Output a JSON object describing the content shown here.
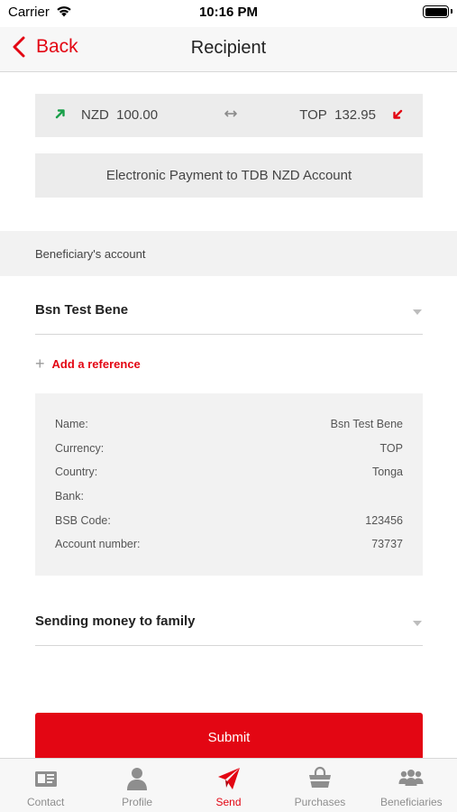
{
  "status_bar": {
    "carrier": "Carrier",
    "time": "10:16 PM"
  },
  "nav": {
    "back_label": "Back",
    "title": "Recipient"
  },
  "exchange": {
    "from_currency": "NZD",
    "from_amount": "100.00",
    "to_currency": "TOP",
    "to_amount": "132.95"
  },
  "payment_method": "Electronic Payment to TDB NZD Account",
  "beneficiary_section": {
    "header": "Beneficiary's account",
    "selected": "Bsn Test Bene"
  },
  "add_reference_label": "Add a reference",
  "details": [
    {
      "label": "Name:",
      "value": "Bsn Test Bene"
    },
    {
      "label": "Currency:",
      "value": "TOP"
    },
    {
      "label": "Country:",
      "value": "Tonga"
    },
    {
      "label": "Bank:",
      "value": ""
    },
    {
      "label": "BSB Code:",
      "value": "123456"
    },
    {
      "label": "Account number:",
      "value": "73737"
    }
  ],
  "purpose": {
    "selected": "Sending money to family"
  },
  "submit_label": "Submit",
  "tabs": [
    {
      "label": "Contact",
      "icon": "contact-card-icon",
      "active": false
    },
    {
      "label": "Profile",
      "icon": "person-icon",
      "active": false
    },
    {
      "label": "Send",
      "icon": "paper-plane-icon",
      "active": true
    },
    {
      "label": "Purchases",
      "icon": "basket-icon",
      "active": false
    },
    {
      "label": "Beneficiaries",
      "icon": "group-icon",
      "active": false
    }
  ],
  "colors": {
    "accent": "#e30613",
    "up_arrow": "#1aa04a",
    "inactive_tab": "#8e8e8e"
  }
}
